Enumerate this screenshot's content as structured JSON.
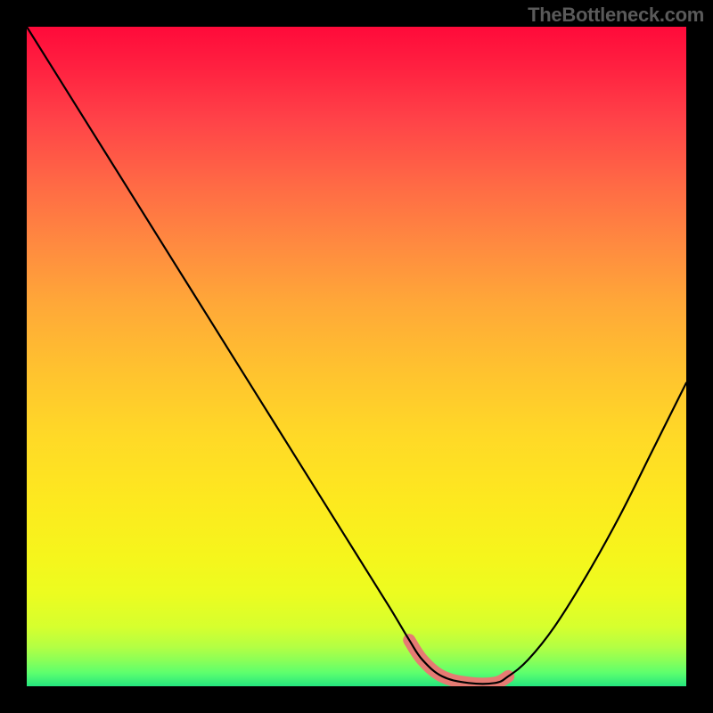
{
  "watermark": "TheBottleneck.com",
  "chart_data": {
    "type": "line",
    "title": "",
    "xlabel": "",
    "ylabel": "",
    "xlim": [
      0,
      100
    ],
    "ylim": [
      0,
      100
    ],
    "grid": false,
    "legend": false,
    "background": {
      "style": "vertical-gradient",
      "stops": [
        {
          "pos": 0,
          "color": "#ff0a3a"
        },
        {
          "pos": 0.5,
          "color": "#ffc22f"
        },
        {
          "pos": 0.9,
          "color": "#ecfc20"
        },
        {
          "pos": 1.0,
          "color": "#25e57e"
        }
      ]
    },
    "series": [
      {
        "name": "bottleneck-curve",
        "color": "#000000",
        "x": [
          0,
          5,
          10,
          15,
          20,
          25,
          30,
          35,
          40,
          45,
          50,
          55,
          58,
          60,
          63,
          67,
          71,
          73,
          76,
          80,
          85,
          90,
          95,
          100
        ],
        "y": [
          100,
          92,
          84,
          76,
          68,
          60,
          52,
          44,
          36,
          28,
          20,
          12,
          7,
          4,
          1.5,
          0.5,
          0.5,
          1.5,
          4,
          9,
          17,
          26,
          36,
          46
        ]
      },
      {
        "name": "highlight-band",
        "color": "#e67b73",
        "style": "thick-segment",
        "x": [
          58,
          60,
          63,
          67,
          71,
          73
        ],
        "y": [
          7,
          4,
          1.5,
          0.5,
          0.5,
          1.5
        ]
      }
    ],
    "annotations": []
  }
}
